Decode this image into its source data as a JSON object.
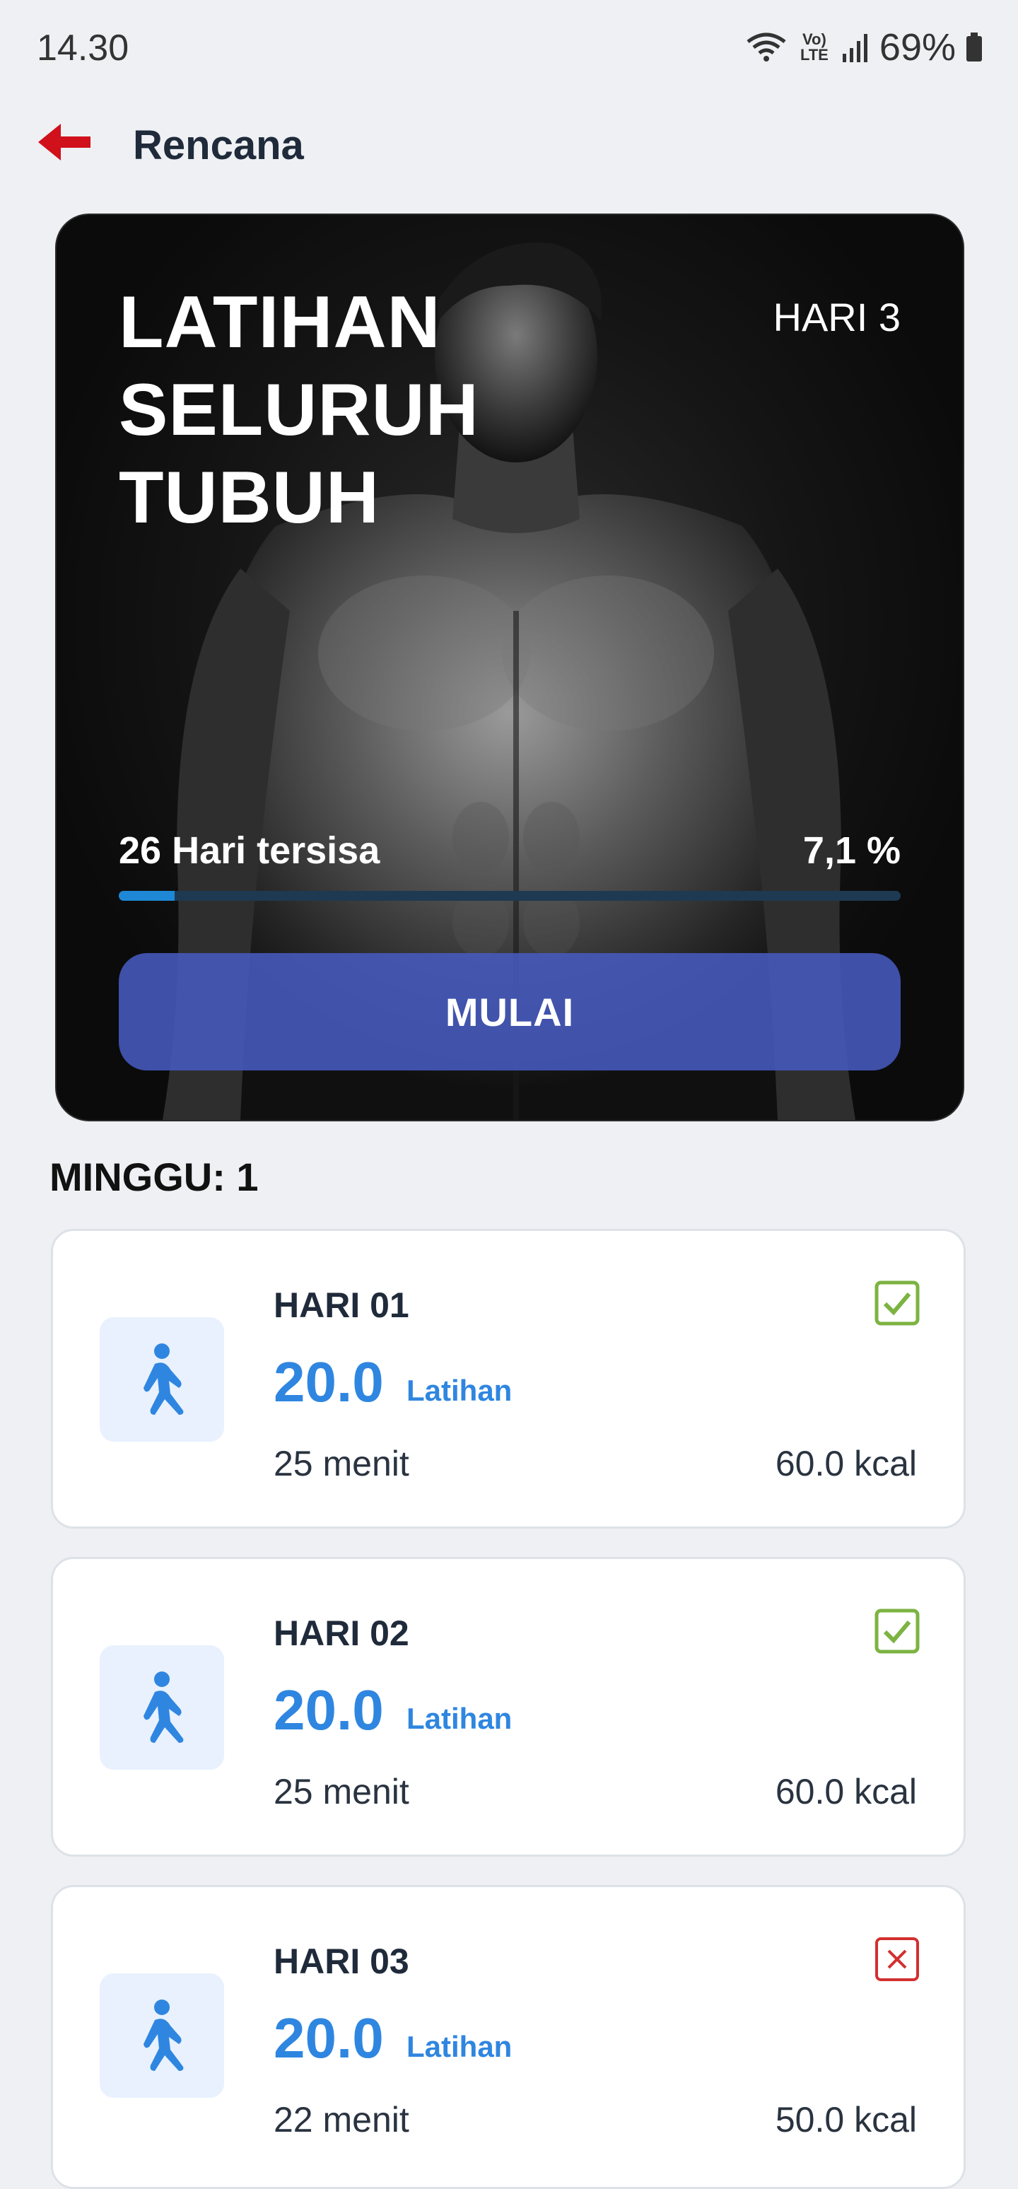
{
  "status_bar": {
    "time": "14.30",
    "battery": "69%",
    "network": "Vo) LTE"
  },
  "header": {
    "title": "Rencana",
    "back_icon": "arrow-left-icon",
    "accent_color": "#d0101b"
  },
  "hero": {
    "title_lines": [
      "LATIHAN",
      "SELURUH",
      "TUBUH"
    ],
    "day_label": "HARI 3",
    "remaining": "26 Hari tersisa",
    "percent": "7,1 %",
    "progress_fraction": 0.071,
    "start_label": "MULAI"
  },
  "week": {
    "label": "MINGGU: 1"
  },
  "days": [
    {
      "title": "HARI 01",
      "count": "20.0",
      "unit": "Latihan",
      "minutes": "25 menit",
      "kcal": "60.0 kcal",
      "status": "done",
      "status_icon": "checkbox-checked-icon"
    },
    {
      "title": "HARI 02",
      "count": "20.0",
      "unit": "Latihan",
      "minutes": "25 menit",
      "kcal": "60.0 kcal",
      "status": "done",
      "status_icon": "checkbox-checked-icon"
    },
    {
      "title": "HARI 03",
      "count": "20.0",
      "unit": "Latihan",
      "minutes": "22 menit",
      "kcal": "50.0 kcal",
      "status": "missed",
      "status_icon": "checkbox-x-icon"
    }
  ],
  "colors": {
    "blue": "#2f86e0",
    "check_green": "#7cb342",
    "cross_red": "#d32f2f",
    "button_blue": "#4a5fc0"
  }
}
